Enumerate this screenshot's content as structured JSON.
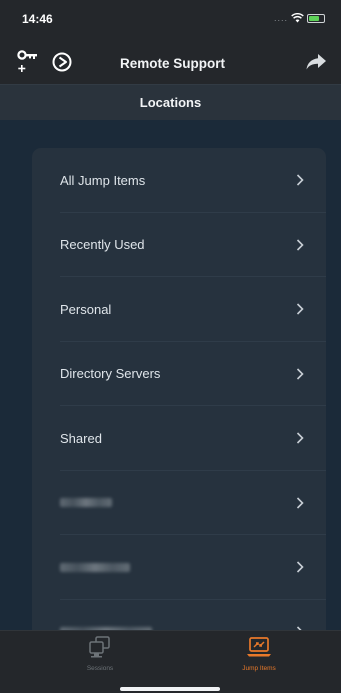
{
  "status_bar": {
    "time": "14:46",
    "signal_dots": "....",
    "battery_icon": "battery-icon",
    "wifi_icon": "wifi-icon"
  },
  "nav": {
    "title": "Remote Support",
    "left_icons": [
      "key-add-icon",
      "remote-session-icon"
    ],
    "right_icon": "share-arrow-icon"
  },
  "sub_header": {
    "title": "Locations"
  },
  "locations": [
    {
      "label": "All Jump Items",
      "blurred": false
    },
    {
      "label": "Recently Used",
      "blurred": false
    },
    {
      "label": "Personal",
      "blurred": false
    },
    {
      "label": "Directory Servers",
      "blurred": false
    },
    {
      "label": "Shared",
      "blurred": false
    },
    {
      "label": "",
      "blurred": true
    },
    {
      "label": "",
      "blurred": true
    },
    {
      "label": "",
      "blurred": true
    }
  ],
  "tabs": [
    {
      "label": "Sessions",
      "icon": "sessions-icon",
      "active": false
    },
    {
      "label": "Jump Items",
      "icon": "jump-items-icon",
      "active": true
    }
  ],
  "colors": {
    "accent": "#e8792a",
    "background": "#1b2a39",
    "card": "#26323e",
    "bars": "#24272b"
  }
}
